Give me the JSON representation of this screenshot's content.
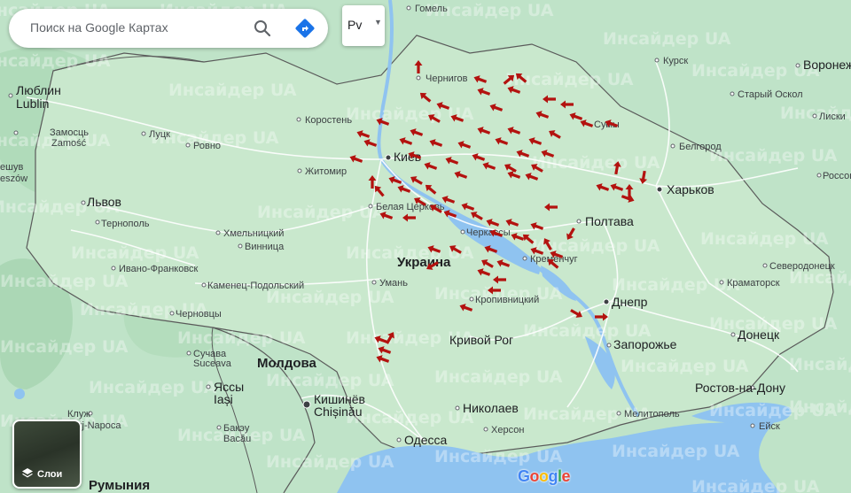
{
  "search": {
    "placeholder": "Поиск на Google Картах"
  },
  "language_button": {
    "label": "Рv"
  },
  "layers_button": {
    "label": "Слои"
  },
  "google_logo": {
    "letters": [
      "G",
      "o",
      "o",
      "g",
      "l",
      "e"
    ],
    "colors": [
      "#4285f4",
      "#ea4335",
      "#fbbc05",
      "#4285f4",
      "#34a853",
      "#ea4335"
    ]
  },
  "watermark": {
    "text": "Инсайдер UA"
  },
  "colors": {
    "land": "#bfe3c8",
    "land_ukraine": "#c9e8cd",
    "water": "#8fc3f0",
    "border": "#5a5a5a",
    "arrow": "#b3120f"
  },
  "labels": {
    "gomel": "Гомель",
    "chernigov": "Чернигов",
    "kursk": "Курск",
    "voronezh": "Воронеж",
    "stary_oskol": "Старый Оскол",
    "lublin_ru": "Люблин",
    "lublin": "Lublin",
    "zamosc_ru": "Замосць",
    "zamosc": "Zamość",
    "lutsk": "Луцк",
    "rovno": "Ровно",
    "korosten": "Коростень",
    "sumy": "Сумы",
    "liski": "Лиски",
    "belgorod": "Белгород",
    "kiev": "Киев",
    "zhitomir": "Житомир",
    "kharkov": "Харьков",
    "rossosh": "Россош",
    "lvov": "Львов",
    "ternopol": "Тернополь",
    "belaya_tserkov": "Белая Церковь",
    "poltava": "Полтава",
    "khmelnitsky": "Хмельницкий",
    "cherkassy": "Черкассы",
    "vinnitsa": "Винница",
    "kremenchug": "Кременчуг",
    "ukraine": "Украина",
    "ivano_frankovsk": "Ивано-Франковск",
    "severodonetsk": "Северодонецк",
    "uman": "Умань",
    "kamenets": "Каменец-Подольский",
    "kramatorsk": "Краматорск",
    "kropivnitsky": "Кропивницкий",
    "dnepr": "Днепр",
    "chernovtsy": "Черновцы",
    "donetsk": "Донецк",
    "krivoy_rog": "Кривой Рог",
    "zaporozhye": "Запорожье",
    "suchava_ru": "Сучава",
    "suceava": "Suceava",
    "moldova": "Молдова",
    "iasi_ru": "Яссы",
    "iasi": "Iași",
    "kishinev_ru": "Кишинёв",
    "chisinau": "Chișinău",
    "rostov": "Ростов-на-Дону",
    "nikolaev": "Николаев",
    "klug_ru": "Клуж",
    "cluj": "Cluj-Napoca",
    "melitopol": "Мелитополь",
    "eisk": "Ейск",
    "bacau_ru": "Бакэу",
    "bacau": "Bacău",
    "kherson": "Херсон",
    "odessa": "Одесса",
    "romania": "Румыния",
    "szheshuv": "ешув",
    "rzeszow": "eszów"
  }
}
